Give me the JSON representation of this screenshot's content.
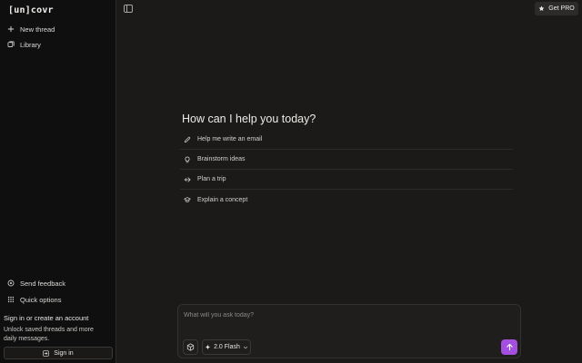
{
  "sidebar": {
    "logo": "[un]covr",
    "new_thread": "New thread",
    "library": "Library",
    "send_feedback": "Send feedback",
    "quick_options": "Quick options",
    "signin_title": "Sign in or create an account",
    "signin_desc": "Unlock saved threads and more daily messages.",
    "signin_button": "Sign in"
  },
  "header": {
    "get_pro": "Get PRO"
  },
  "main": {
    "heading": "How can I help you today?",
    "suggestions": [
      {
        "label": "Help me write an email",
        "icon": "pencil-icon"
      },
      {
        "label": "Brainstorm ideas",
        "icon": "lightbulb-icon"
      },
      {
        "label": "Plan a trip",
        "icon": "plane-icon"
      },
      {
        "label": "Explain a concept",
        "icon": "graduation-cap-icon"
      }
    ]
  },
  "composer": {
    "placeholder": "What will you ask today?",
    "value": "",
    "model": "2.0 Flash"
  },
  "colors": {
    "accent": "#a44fe0",
    "background": "#1b1a19",
    "sidebar": "#0f0f0f"
  }
}
